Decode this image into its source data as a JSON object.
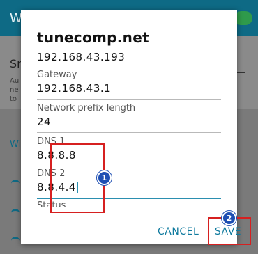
{
  "background": {
    "title": "Wi",
    "toggle_state": "on",
    "row_title": "Sn",
    "row_sub": "Au ne to",
    "section": "Wi"
  },
  "dialog": {
    "title": "tunecomp.net",
    "ip_value": "192.168.43.193",
    "gateway_label": "Gateway",
    "gateway_value": "192.168.43.1",
    "prefix_label": "Network prefix length",
    "prefix_value": "24",
    "dns1_label": "DNS 1",
    "dns1_value": "8.8.8.8",
    "dns2_label": "DNS 2",
    "dns2_value": "8.8.4.4",
    "status_label": "Status",
    "cancel_label": "CANCEL",
    "save_label": "SAVE"
  },
  "annotations": {
    "badge1": "1",
    "badge2": "2",
    "highlight_color": "#d62020",
    "badge_color": "#1e4fb3"
  }
}
